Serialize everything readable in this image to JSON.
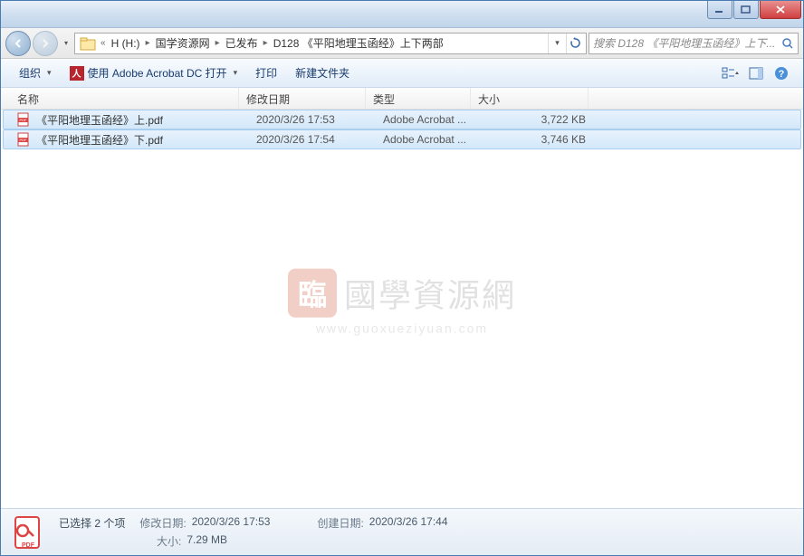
{
  "breadcrumb": {
    "items": [
      "H (H:)",
      "国学资源网",
      "已发布",
      "D128 《平阳地理玉函经》上下两部"
    ]
  },
  "search": {
    "placeholder": "搜索 D128 《平阳地理玉函经》上下..."
  },
  "toolbar": {
    "organize": "组织",
    "open_with": "使用 Adobe Acrobat DC 打开",
    "print": "打印",
    "new_folder": "新建文件夹"
  },
  "columns": {
    "name": "名称",
    "date": "修改日期",
    "type": "类型",
    "size": "大小"
  },
  "files": [
    {
      "name": "《平阳地理玉函经》上.pdf",
      "date": "2020/3/26 17:53",
      "type": "Adobe Acrobat ...",
      "size": "3,722 KB"
    },
    {
      "name": "《平阳地理玉函经》下.pdf",
      "date": "2020/3/26 17:54",
      "type": "Adobe Acrobat ...",
      "size": "3,746 KB"
    }
  ],
  "watermark": {
    "seal": "臨",
    "text": "國學資源網",
    "url": "www.guoxueziyuan.com"
  },
  "status": {
    "title": "已选择 2 个项",
    "mod_label": "修改日期:",
    "mod_value": "2020/3/26 17:53",
    "size_label": "大小:",
    "size_value": "7.29 MB",
    "create_label": "创建日期:",
    "create_value": "2020/3/26 17:44"
  }
}
